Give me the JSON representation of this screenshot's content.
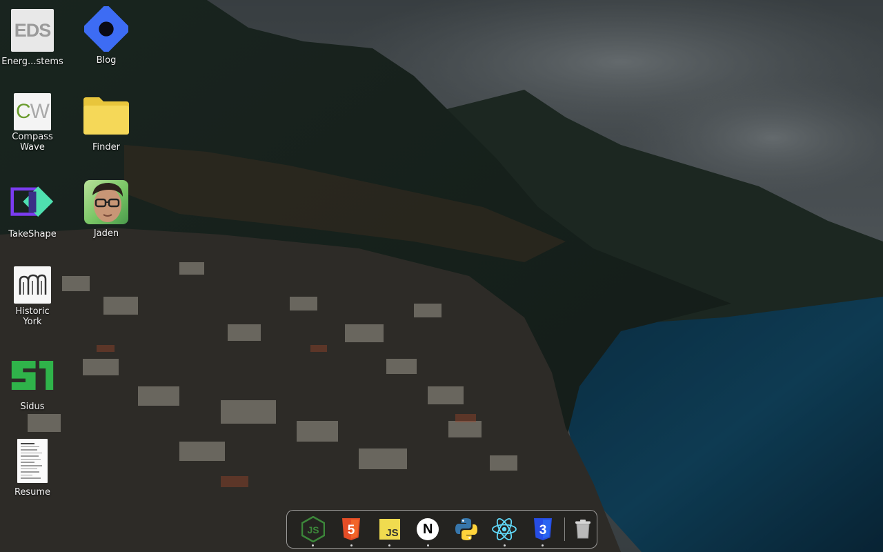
{
  "desktop_icons": [
    {
      "id": "eds",
      "label": "Energ...stems",
      "icon": "eds-logo-icon",
      "tile_text": "EDS"
    },
    {
      "id": "blog",
      "label": "Blog",
      "icon": "blog-icon"
    },
    {
      "id": "compass-wave",
      "label": "Compass\nWave",
      "icon": "cw-logo-icon",
      "tile_text_c": "C",
      "tile_text_w": "W"
    },
    {
      "id": "finder",
      "label": "Finder",
      "icon": "folder-icon"
    },
    {
      "id": "takeshape",
      "label": "TakeShape",
      "icon": "takeshape-logo-icon"
    },
    {
      "id": "jaden",
      "label": "Jaden",
      "icon": "avatar-icon"
    },
    {
      "id": "historic-york",
      "label": "Historic\nYork",
      "icon": "historic-york-logo-icon"
    },
    {
      "id": "sidus",
      "label": "Sidus",
      "icon": "sidus-logo-icon"
    },
    {
      "id": "resume",
      "label": "Resume",
      "icon": "document-icon"
    }
  ],
  "dock": {
    "items": [
      {
        "name": "nodejs",
        "icon": "nodejs-icon",
        "running": true
      },
      {
        "name": "html5",
        "icon": "html5-icon",
        "running": true,
        "badge": "5"
      },
      {
        "name": "javascript",
        "icon": "javascript-icon",
        "running": true,
        "badge": "JS"
      },
      {
        "name": "nextjs",
        "icon": "nextjs-icon",
        "running": true,
        "badge": "N"
      },
      {
        "name": "python",
        "icon": "python-icon",
        "running": false
      },
      {
        "name": "react",
        "icon": "react-icon",
        "running": true
      },
      {
        "name": "css3",
        "icon": "css3-icon",
        "running": true,
        "badge": "3"
      },
      {
        "name": "trash",
        "icon": "trash-icon",
        "running": false
      }
    ]
  },
  "colors": {
    "node_green": "#3c873a",
    "html_orange": "#e44d26",
    "js_yellow": "#f0db4f",
    "python_blue": "#3776ab",
    "python_yellow": "#ffd43b",
    "react_cyan": "#61dafb",
    "css_blue": "#264de4",
    "blog_blue": "#3d6cf4",
    "folder_yellow": "#f5d858",
    "sidus_green": "#2fb34a"
  }
}
